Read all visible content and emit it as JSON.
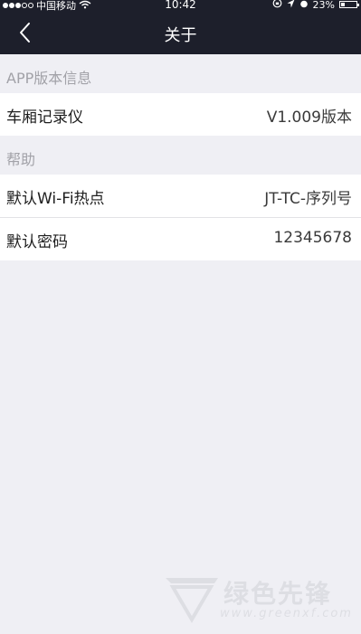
{
  "status_bar": {
    "carrier": "中国移动",
    "time": "10:42",
    "battery": "23%",
    "battery_level": 0.23
  },
  "nav": {
    "title": "关于",
    "back_icon": "chevron-left-icon"
  },
  "sections": [
    {
      "header": "APP版本信息",
      "rows": [
        {
          "label": "车厢记录仪",
          "value": "V1.009版本"
        }
      ]
    },
    {
      "header": "帮助",
      "rows": [
        {
          "label": "默认Wi-Fi热点",
          "value": "JT-TC-序列号"
        },
        {
          "label": "默认密码",
          "value": "12345678"
        }
      ]
    }
  ],
  "watermark": {
    "text": "绿色先锋",
    "url": "www.greenxf.com"
  }
}
